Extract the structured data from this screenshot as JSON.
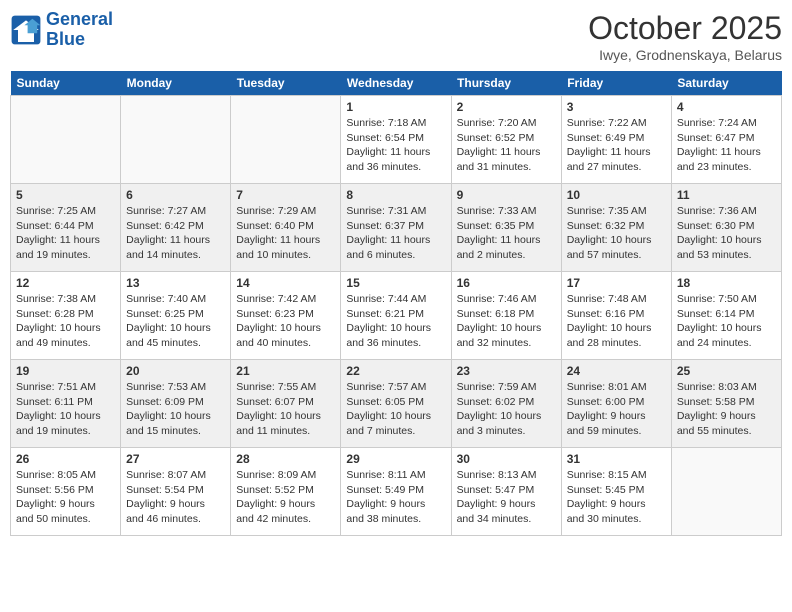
{
  "header": {
    "logo_line1": "General",
    "logo_line2": "Blue",
    "month_title": "October 2025",
    "location": "Iwye, Grodnenskaya, Belarus"
  },
  "days_of_week": [
    "Sunday",
    "Monday",
    "Tuesday",
    "Wednesday",
    "Thursday",
    "Friday",
    "Saturday"
  ],
  "weeks": [
    [
      {
        "day": "",
        "info": ""
      },
      {
        "day": "",
        "info": ""
      },
      {
        "day": "",
        "info": ""
      },
      {
        "day": "1",
        "info": "Sunrise: 7:18 AM\nSunset: 6:54 PM\nDaylight: 11 hours\nand 36 minutes."
      },
      {
        "day": "2",
        "info": "Sunrise: 7:20 AM\nSunset: 6:52 PM\nDaylight: 11 hours\nand 31 minutes."
      },
      {
        "day": "3",
        "info": "Sunrise: 7:22 AM\nSunset: 6:49 PM\nDaylight: 11 hours\nand 27 minutes."
      },
      {
        "day": "4",
        "info": "Sunrise: 7:24 AM\nSunset: 6:47 PM\nDaylight: 11 hours\nand 23 minutes."
      }
    ],
    [
      {
        "day": "5",
        "info": "Sunrise: 7:25 AM\nSunset: 6:44 PM\nDaylight: 11 hours\nand 19 minutes."
      },
      {
        "day": "6",
        "info": "Sunrise: 7:27 AM\nSunset: 6:42 PM\nDaylight: 11 hours\nand 14 minutes."
      },
      {
        "day": "7",
        "info": "Sunrise: 7:29 AM\nSunset: 6:40 PM\nDaylight: 11 hours\nand 10 minutes."
      },
      {
        "day": "8",
        "info": "Sunrise: 7:31 AM\nSunset: 6:37 PM\nDaylight: 11 hours\nand 6 minutes."
      },
      {
        "day": "9",
        "info": "Sunrise: 7:33 AM\nSunset: 6:35 PM\nDaylight: 11 hours\nand 2 minutes."
      },
      {
        "day": "10",
        "info": "Sunrise: 7:35 AM\nSunset: 6:32 PM\nDaylight: 10 hours\nand 57 minutes."
      },
      {
        "day": "11",
        "info": "Sunrise: 7:36 AM\nSunset: 6:30 PM\nDaylight: 10 hours\nand 53 minutes."
      }
    ],
    [
      {
        "day": "12",
        "info": "Sunrise: 7:38 AM\nSunset: 6:28 PM\nDaylight: 10 hours\nand 49 minutes."
      },
      {
        "day": "13",
        "info": "Sunrise: 7:40 AM\nSunset: 6:25 PM\nDaylight: 10 hours\nand 45 minutes."
      },
      {
        "day": "14",
        "info": "Sunrise: 7:42 AM\nSunset: 6:23 PM\nDaylight: 10 hours\nand 40 minutes."
      },
      {
        "day": "15",
        "info": "Sunrise: 7:44 AM\nSunset: 6:21 PM\nDaylight: 10 hours\nand 36 minutes."
      },
      {
        "day": "16",
        "info": "Sunrise: 7:46 AM\nSunset: 6:18 PM\nDaylight: 10 hours\nand 32 minutes."
      },
      {
        "day": "17",
        "info": "Sunrise: 7:48 AM\nSunset: 6:16 PM\nDaylight: 10 hours\nand 28 minutes."
      },
      {
        "day": "18",
        "info": "Sunrise: 7:50 AM\nSunset: 6:14 PM\nDaylight: 10 hours\nand 24 minutes."
      }
    ],
    [
      {
        "day": "19",
        "info": "Sunrise: 7:51 AM\nSunset: 6:11 PM\nDaylight: 10 hours\nand 19 minutes."
      },
      {
        "day": "20",
        "info": "Sunrise: 7:53 AM\nSunset: 6:09 PM\nDaylight: 10 hours\nand 15 minutes."
      },
      {
        "day": "21",
        "info": "Sunrise: 7:55 AM\nSunset: 6:07 PM\nDaylight: 10 hours\nand 11 minutes."
      },
      {
        "day": "22",
        "info": "Sunrise: 7:57 AM\nSunset: 6:05 PM\nDaylight: 10 hours\nand 7 minutes."
      },
      {
        "day": "23",
        "info": "Sunrise: 7:59 AM\nSunset: 6:02 PM\nDaylight: 10 hours\nand 3 minutes."
      },
      {
        "day": "24",
        "info": "Sunrise: 8:01 AM\nSunset: 6:00 PM\nDaylight: 9 hours\nand 59 minutes."
      },
      {
        "day": "25",
        "info": "Sunrise: 8:03 AM\nSunset: 5:58 PM\nDaylight: 9 hours\nand 55 minutes."
      }
    ],
    [
      {
        "day": "26",
        "info": "Sunrise: 8:05 AM\nSunset: 5:56 PM\nDaylight: 9 hours\nand 50 minutes."
      },
      {
        "day": "27",
        "info": "Sunrise: 8:07 AM\nSunset: 5:54 PM\nDaylight: 9 hours\nand 46 minutes."
      },
      {
        "day": "28",
        "info": "Sunrise: 8:09 AM\nSunset: 5:52 PM\nDaylight: 9 hours\nand 42 minutes."
      },
      {
        "day": "29",
        "info": "Sunrise: 8:11 AM\nSunset: 5:49 PM\nDaylight: 9 hours\nand 38 minutes."
      },
      {
        "day": "30",
        "info": "Sunrise: 8:13 AM\nSunset: 5:47 PM\nDaylight: 9 hours\nand 34 minutes."
      },
      {
        "day": "31",
        "info": "Sunrise: 8:15 AM\nSunset: 5:45 PM\nDaylight: 9 hours\nand 30 minutes."
      },
      {
        "day": "",
        "info": ""
      }
    ]
  ]
}
